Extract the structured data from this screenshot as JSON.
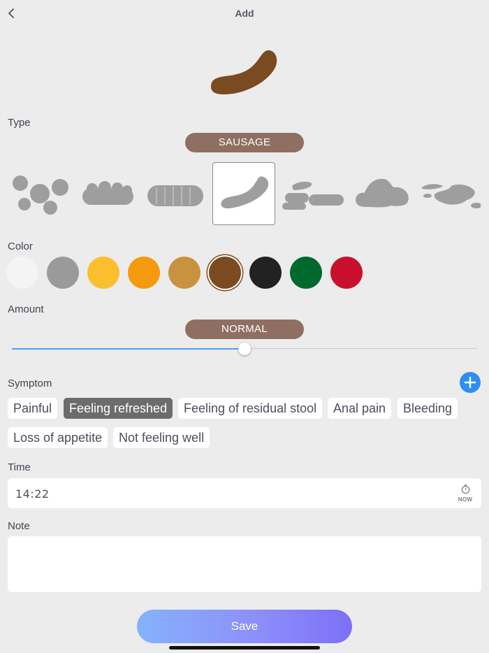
{
  "header": {
    "title": "Add"
  },
  "type_section": {
    "label": "Type",
    "selected": "SAUSAGE",
    "items": [
      "lumps",
      "lumpy-sausage",
      "cracked-sausage",
      "sausage",
      "soft-blobs",
      "mushy",
      "watery"
    ],
    "selected_index": 3
  },
  "color_section": {
    "label": "Color",
    "swatches": [
      "#f4f4f4",
      "#9a9a9a",
      "#fbbf2e",
      "#f59a0d",
      "#c8923f",
      "#7a4a20",
      "#222222",
      "#00692e",
      "#c8102e"
    ],
    "selected_index": 5
  },
  "amount_section": {
    "label": "Amount",
    "value": "NORMAL",
    "level": 0.5
  },
  "symptom_section": {
    "label": "Symptom",
    "chips": [
      {
        "label": "Painful",
        "active": false
      },
      {
        "label": "Feeling refreshed",
        "active": true
      },
      {
        "label": "Feeling of residual stool",
        "active": false
      },
      {
        "label": "Anal pain",
        "active": false
      },
      {
        "label": "Bleeding",
        "active": false
      },
      {
        "label": "Loss of appetite",
        "active": false
      },
      {
        "label": "Not feeling well",
        "active": false
      }
    ]
  },
  "time_section": {
    "label": "Time",
    "value": "14:22",
    "now_label": "NOW"
  },
  "note_section": {
    "label": "Note",
    "value": ""
  },
  "save_label": "Save",
  "colors": {
    "accent": "#2e8ff0",
    "pill": "#8f6f62",
    "stool_brown": "#7a4a20",
    "shape_gray": "#9e9e9e"
  }
}
